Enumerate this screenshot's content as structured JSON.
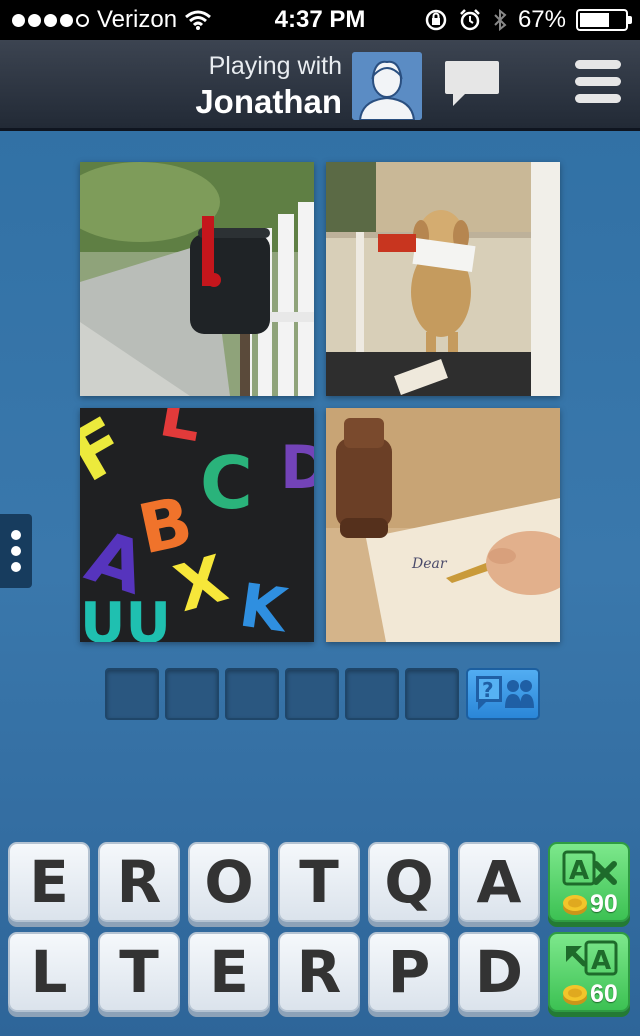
{
  "status_bar": {
    "carrier": "Verizon",
    "time": "4:37 PM",
    "battery": "67%",
    "battery_level": 0.67,
    "signal_bars_filled": 4,
    "signal_bars_total": 5
  },
  "header": {
    "playing_with_label": "Playing with",
    "opponent_name": "Jonathan",
    "icons": {
      "avatar": "person-avatar-icon",
      "chat": "chat-bubble-icon",
      "menu": "hamburger-menu-icon"
    }
  },
  "puzzle": {
    "photos": [
      "mailbox",
      "dog-with-mail",
      "alphabet-magnets",
      "pen-writing"
    ],
    "answer_slots": 6,
    "hint_icon": "question-friends-icon"
  },
  "letters": {
    "row1": [
      "E",
      "R",
      "O",
      "T",
      "Q",
      "A"
    ],
    "row2": [
      "L",
      "T",
      "E",
      "R",
      "P",
      "D"
    ]
  },
  "powerups": {
    "remove_letters": {
      "cost": "90",
      "icon": "remove-letter-icon"
    },
    "reveal_letter": {
      "cost": "60",
      "icon": "reveal-letter-icon"
    }
  },
  "colors": {
    "background": "#3a78ac",
    "header": "#2a323e",
    "tile": "#e6ecf2",
    "powerup": "#4fd160",
    "hint": "#3b9be6"
  }
}
